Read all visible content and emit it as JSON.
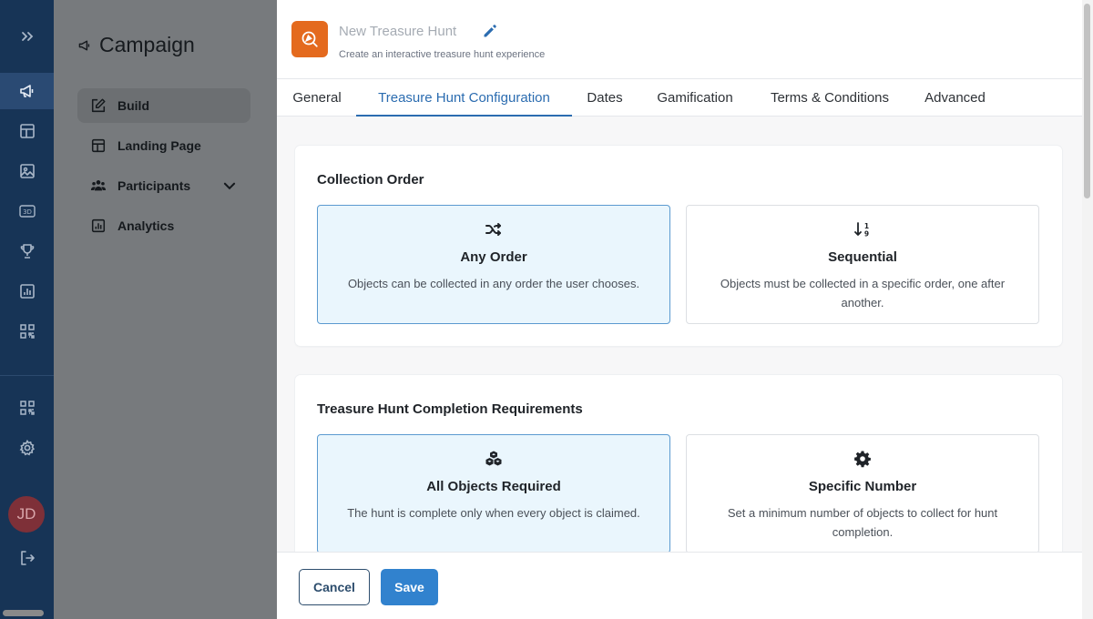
{
  "rail": {
    "icons": [
      "expand-icon",
      "megaphone-icon",
      "layout-icon",
      "image-icon",
      "3d-icon",
      "trophy-icon",
      "chart-icon",
      "qr-icon",
      "qr-code-icon",
      "settings-icon",
      "logout-icon"
    ],
    "rail_3d_label": "3D",
    "avatar_initials": "JD"
  },
  "sidebar": {
    "title": "Campaign",
    "items": [
      {
        "label": "Build",
        "active": true
      },
      {
        "label": "Landing Page"
      },
      {
        "label": "Participants",
        "has_dropdown": true
      },
      {
        "label": "Analytics"
      }
    ]
  },
  "header": {
    "title": "New Treasure Hunt",
    "subtitle": "Create an interactive treasure hunt experience",
    "icon_color": "#e46a1e"
  },
  "tabs": [
    {
      "label": "General"
    },
    {
      "label": "Treasure Hunt Configuration",
      "active": true
    },
    {
      "label": "Dates"
    },
    {
      "label": "Gamification"
    },
    {
      "label": "Terms & Conditions"
    },
    {
      "label": "Advanced"
    }
  ],
  "collection_order": {
    "title": "Collection Order",
    "options": [
      {
        "icon": "shuffle-icon",
        "title": "Any Order",
        "desc": "Objects can be collected in any order the user chooses.",
        "selected": true
      },
      {
        "icon": "sort-numeric-icon",
        "title": "Sequential",
        "desc": "Objects must be collected in a specific order, one after another.",
        "selected": false
      }
    ]
  },
  "completion": {
    "title": "Treasure Hunt Completion Requirements",
    "options": [
      {
        "icon": "cubes-icon",
        "title": "All Objects Required",
        "desc": "The hunt is complete only when every object is claimed.",
        "selected": true
      },
      {
        "icon": "cog-icon",
        "title": "Specific Number",
        "desc": "Set a minimum number of objects to collect for hunt completion.",
        "selected": false
      }
    ]
  },
  "footer": {
    "cancel_label": "Cancel",
    "save_label": "Save"
  },
  "colors": {
    "accent": "#3182ce",
    "selected_bg": "#eaf6fd",
    "rail_bg": "#173456"
  }
}
